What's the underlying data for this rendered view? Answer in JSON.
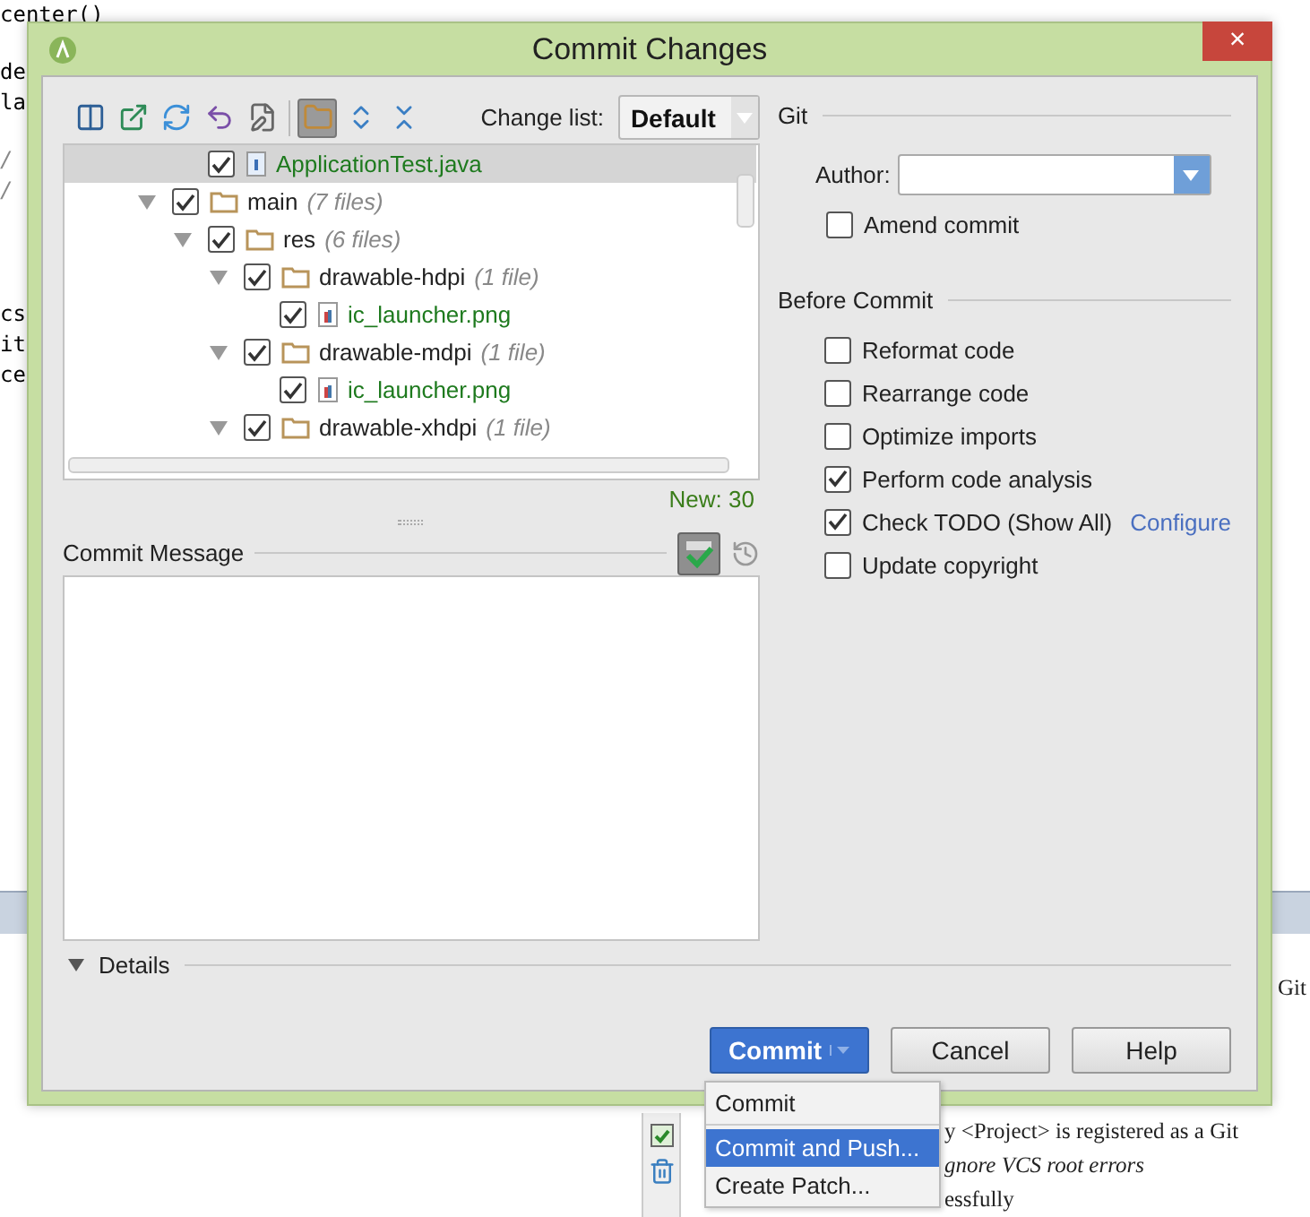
{
  "background": {
    "code_lines": [
      {
        "text": "center()",
        "kind": "code"
      },
      {
        "text": "de",
        "kind": "code"
      },
      {
        "text": "la",
        "kind": "code"
      },
      {
        "text": "/",
        "kind": "comment"
      },
      {
        "text": "/",
        "kind": "comment"
      },
      {
        "text": "cs",
        "kind": "code"
      },
      {
        "text": "it",
        "kind": "code"
      },
      {
        "text": "ce",
        "kind": "code"
      }
    ],
    "right_text": "Git",
    "log_lines": [
      {
        "text": "y <Project> is registered as a Git",
        "italic": false
      },
      {
        "text": "gnore VCS root errors",
        "italic": true
      },
      {
        "text": "essfully",
        "italic": false
      }
    ]
  },
  "window": {
    "title": "Commit Changes",
    "close": "×"
  },
  "toolbar": {
    "group_toggle": {
      "selected": true
    },
    "change_list_label": "Change list:",
    "change_list": "Default"
  },
  "tree": {
    "items": [
      {
        "children": [
          {
            "label": "ApplicationTest.java",
            "kind": "file",
            "checked": true,
            "selected": true
          }
        ]
      },
      {
        "label": "main",
        "count": "(7 files)",
        "kind": "folder",
        "checked": true,
        "expanded": true,
        "selected": false,
        "children": [
          {
            "label": "res",
            "count": "(6 files)",
            "kind": "folder",
            "checked": true,
            "expanded": true,
            "selected": false,
            "children": [
              {
                "label": "drawable-hdpi",
                "count": "(1 file)",
                "kind": "folder",
                "checked": true,
                "expanded": true,
                "selected": false,
                "children": [
                  {
                    "label": "ic_launcher.png",
                    "kind": "image",
                    "checked": true,
                    "selected": false
                  }
                ]
              },
              {
                "label": "drawable-mdpi",
                "count": "(1 file)",
                "kind": "folder",
                "checked": true,
                "expanded": true,
                "selected": false,
                "children": [
                  {
                    "label": "ic_launcher.png",
                    "kind": "image",
                    "checked": true,
                    "selected": false
                  }
                ]
              },
              {
                "label": "drawable-xhdpi",
                "count": "(1 file)",
                "kind": "folder",
                "checked": true,
                "expanded": true,
                "selected": false
              }
            ]
          }
        ]
      }
    ]
  },
  "new_count": "New: 30",
  "commit_message": {
    "label": "Commit Message",
    "spellcheck": {
      "selected": true
    }
  },
  "details": {
    "label": "Details"
  },
  "git": {
    "heading": "Git",
    "author_label": "Author:",
    "amend": {
      "label": "Amend commit",
      "checked": false
    }
  },
  "before_commit": {
    "heading": "Before Commit",
    "options": [
      {
        "label": "Reformat code",
        "checked": false
      },
      {
        "label": "Rearrange code",
        "checked": false
      },
      {
        "label": "Optimize imports",
        "checked": false
      },
      {
        "label": "Perform code analysis",
        "checked": true
      },
      {
        "label": "Check TODO (Show All)",
        "checked": true,
        "link": "Configure"
      },
      {
        "label": "Update copyright",
        "checked": false
      }
    ]
  },
  "buttons": [
    {
      "label": "Commit",
      "kind": "primary"
    },
    {
      "label": "Cancel",
      "kind": "normal"
    },
    {
      "label": "Help",
      "kind": "normal"
    }
  ],
  "menu": [
    {
      "label": "Commit",
      "selected": false
    },
    {
      "label": "Commit and Push...",
      "selected": true
    },
    {
      "label": "Create Patch...",
      "selected": false
    }
  ]
}
